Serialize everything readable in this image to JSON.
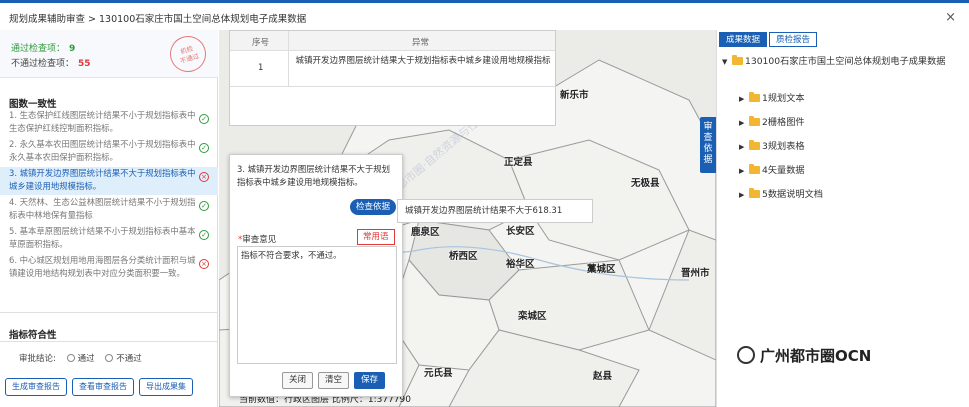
{
  "window": {
    "title": "规划成果辅助审查 > 130100石家庄市国土空间总体规划电子成果数据",
    "close_glyph": "×"
  },
  "stats": {
    "pass_label": "通过检查项：",
    "pass_count": "9",
    "fail_label": "不通过检查项：",
    "fail_count": "55",
    "stamp_text": "机检\n不通过"
  },
  "left": {
    "section1": "图数一致性",
    "rules": [
      {
        "text": "1. 生态保护红线图层统计结果不小于规划指标表中生态保护红线控制面积指标。",
        "status": "ok"
      },
      {
        "text": "2. 永久基本农田图层统计结果不小于规划指标表中永久基本农田保护面积指标。",
        "status": "ok"
      },
      {
        "text": "3. 城镇开发边界图层统计结果不大于规划指标表中城乡建设用地规模指标。",
        "status": "bad"
      },
      {
        "text": "4. 天然林、生态公益林图层统计结果不小于规划指标表中林地保有量指标",
        "status": "ok"
      },
      {
        "text": "5. 基本草原图层统计结果不小于规划指标表中基本草原面积指标。",
        "status": "ok"
      },
      {
        "text": "6. 中心城区规划用地用海图层各分类统计面积与城镇建设用地结构规划表中对应分类面积要一致。",
        "status": "bad"
      }
    ],
    "section2": "指标符合性",
    "verdict_label": "审批结论:",
    "verdict_pass": "通过",
    "verdict_fail": "不通过",
    "buttons": [
      "生成审查报告",
      "查看审查报告",
      "导出成果集"
    ]
  },
  "table": {
    "col_index": "序号",
    "col_issue": "异常",
    "rows": [
      {
        "index": "1",
        "issue": "城镇开发边界图层统计结果大于规划指标表中城乡建设用地规模指标"
      }
    ]
  },
  "dialog": {
    "question": "3. 城镇开发边界图层统计结果不大于规划指标表中城乡建设用地规模指标。",
    "basis_button": "检查依据",
    "opinion_star": "*",
    "opinion_label": "审查意见",
    "common_button": "常用语",
    "opinion_value": "指标不符合要求，不通过。",
    "close_button": "关闭",
    "clear_button": "清空",
    "save_button": "保存"
  },
  "tooltip": "城镇开发边界图层统计结果不大于618.31",
  "map": {
    "vtab": "审查依据",
    "cities": [
      "新乐市",
      "正定县",
      "无极县",
      "鹿泉区",
      "长安区",
      "桥西区",
      "裕华区",
      "藁城区",
      "晋州市",
      "栾城区",
      "元氏县",
      "赵县"
    ],
    "watermark": "OCN都市圈·自然资源与住建事业部",
    "scale_label": "当前数值：行政区图层   比例尺：",
    "scale_value": "1:377790"
  },
  "right": {
    "tab_data": "成果数据",
    "tab_report": "质检报告",
    "root": "130100石家庄市国土空间总体规划电子成果数据",
    "children": [
      "1规划文本",
      "2栅格图件",
      "3规划表格",
      "4矢量数据",
      "5数据说明文档"
    ]
  },
  "brand": "广州都市圈OCN",
  "colors": {
    "primary": "#1a5fb4",
    "pass": "#2e9b3b",
    "fail": "#e03a3a",
    "folder": "#f2b632"
  }
}
